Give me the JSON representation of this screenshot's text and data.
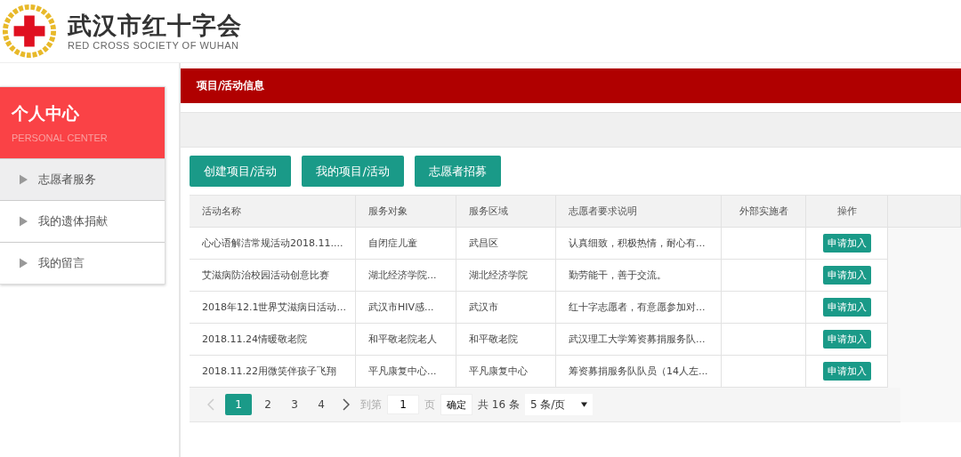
{
  "header": {
    "title": "武汉市红十字会",
    "subtitle": "RED CROSS SOCIETY OF WUHAN"
  },
  "sidebar": {
    "title": "个人中心",
    "subtitle": "PERSONAL CENTER",
    "items": [
      {
        "label": "志愿者服务",
        "selected": true
      },
      {
        "label": "我的遗体捐献",
        "selected": false
      },
      {
        "label": "我的留言",
        "selected": false
      }
    ]
  },
  "panel": {
    "title": "项目/活动信息"
  },
  "actions": [
    "创建项目/活动",
    "我的项目/活动",
    "志愿者招募"
  ],
  "table": {
    "columns": [
      "活动名称",
      "服务对象",
      "服务区域",
      "志愿者要求说明",
      "外部实施者",
      "操作"
    ],
    "rows": [
      {
        "cells": [
          "心心语解洁常规活动2018.11....",
          "自闭症儿童",
          "武昌区",
          "认真细致，积极热情，耐心有..."
        ],
        "action": "申请加入"
      },
      {
        "cells": [
          "艾滋病防治校园活动创意比赛",
          "湖北经济学院...",
          "湖北经济学院",
          "勤劳能干，善于交流。"
        ],
        "action": "申请加入"
      },
      {
        "cells": [
          "2018年12.1世界艾滋病日活动...",
          "武汉市HIV感...",
          "武汉市",
          "红十字志愿者，有意愿参加对..."
        ],
        "action": "申请加入"
      },
      {
        "cells": [
          "2018.11.24情暖敬老院",
          "和平敬老院老人",
          "和平敬老院",
          "武汉理工大学筹资募捐服务队..."
        ],
        "action": "申请加入"
      },
      {
        "cells": [
          "2018.11.22用微笑伴孩子飞翔",
          "平凡康复中心...",
          "平凡康复中心",
          "筹资募捐服务队队员（14人左..."
        ],
        "action": "申请加入"
      }
    ]
  },
  "pagination": {
    "pages": [
      {
        "label": "1",
        "selected": true
      },
      {
        "label": "2",
        "selected": false
      },
      {
        "label": "3",
        "selected": false
      },
      {
        "label": "4",
        "selected": false
      }
    ],
    "goto_label": "到第",
    "page_value": "1",
    "page_unit": "页",
    "confirm": "确定",
    "total": "共 16 条",
    "page_size": "5 条/页"
  }
}
